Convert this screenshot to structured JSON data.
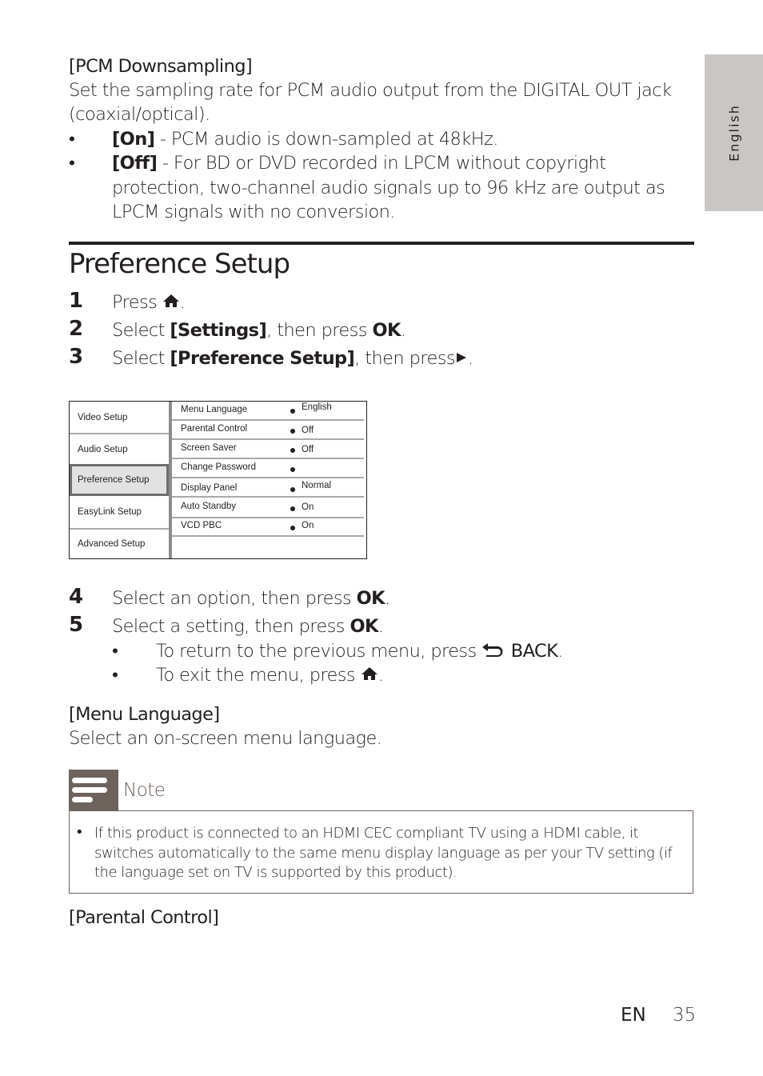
{
  "side_tab": {
    "label": "English"
  },
  "pcm": {
    "heading": "[PCM Downsampling]",
    "desc_line1": "Set the sampling rate for PCM audio output from the DIGITAL OUT jack",
    "desc_line2": "(coaxial/optical).",
    "options": [
      {
        "key": "[On]",
        "text": " - PCM audio is down-sampled at 48kHz."
      },
      {
        "key": "[Off]",
        "text": " - For BD or DVD recorded in LPCM without copyright",
        "cont1": "protection, two-channel audio signals up to 96 kHz are output as",
        "cont2": "LPCM signals with no conversion."
      }
    ]
  },
  "section": {
    "title": "Preference Setup"
  },
  "steps": [
    {
      "num": "1",
      "pre": "Press ",
      "icon": "home-icon",
      "post": "."
    },
    {
      "num": "2",
      "pre": "Select ",
      "bold": "[Settings]",
      "mid": ", then press ",
      "bold2": "OK",
      "post": "."
    },
    {
      "num": "3",
      "pre": "Select ",
      "bold": "[Preference Setup]",
      "mid": ", then press",
      "icon": "play-icon",
      "post": "."
    },
    {
      "num": "4",
      "pre": "Select an option, then press ",
      "bold": "OK",
      "post": "."
    },
    {
      "num": "5",
      "pre": "Select a setting, then press ",
      "bold": "OK",
      "post": "."
    }
  ],
  "substeps": [
    {
      "pre": "To return to the previous menu, press ",
      "icon": "back-icon",
      "bold": " BACK",
      "post": "."
    },
    {
      "pre": "To exit the menu, press ",
      "icon": "home-icon",
      "post": "."
    }
  ],
  "menu": {
    "left_items": [
      {
        "label": "Video Setup",
        "selected": false
      },
      {
        "label": "Audio Setup",
        "selected": false
      },
      {
        "label": "Preference Setup",
        "selected": true
      },
      {
        "label": "EasyLink Setup",
        "selected": false
      },
      {
        "label": "Advanced Setup",
        "selected": false
      }
    ],
    "rows": [
      {
        "label": "Menu Language",
        "value": "English"
      },
      {
        "label": "Parental Control",
        "value": "Off"
      },
      {
        "label": "Screen Saver",
        "value": "Off"
      },
      {
        "label": "Change Password",
        "value": ""
      },
      {
        "label": "Display Panel",
        "value": "Normal"
      },
      {
        "label": "Auto Standby",
        "value": "On"
      },
      {
        "label": "VCD PBC",
        "value": "On"
      }
    ]
  },
  "menu_language": {
    "heading": "[Menu Language]",
    "desc": "Select an on-screen menu language."
  },
  "note": {
    "title": "Note",
    "bullet": "•",
    "text": "If this product is connected to an HDMI CEC compliant TV using a HDMI cable, it switches automatically to the same menu display language as per your TV setting (if the language set on TV is supported by this product)."
  },
  "parental_control": {
    "heading": "[Parental Control]"
  },
  "footer": {
    "lang": "EN",
    "page": "35"
  }
}
